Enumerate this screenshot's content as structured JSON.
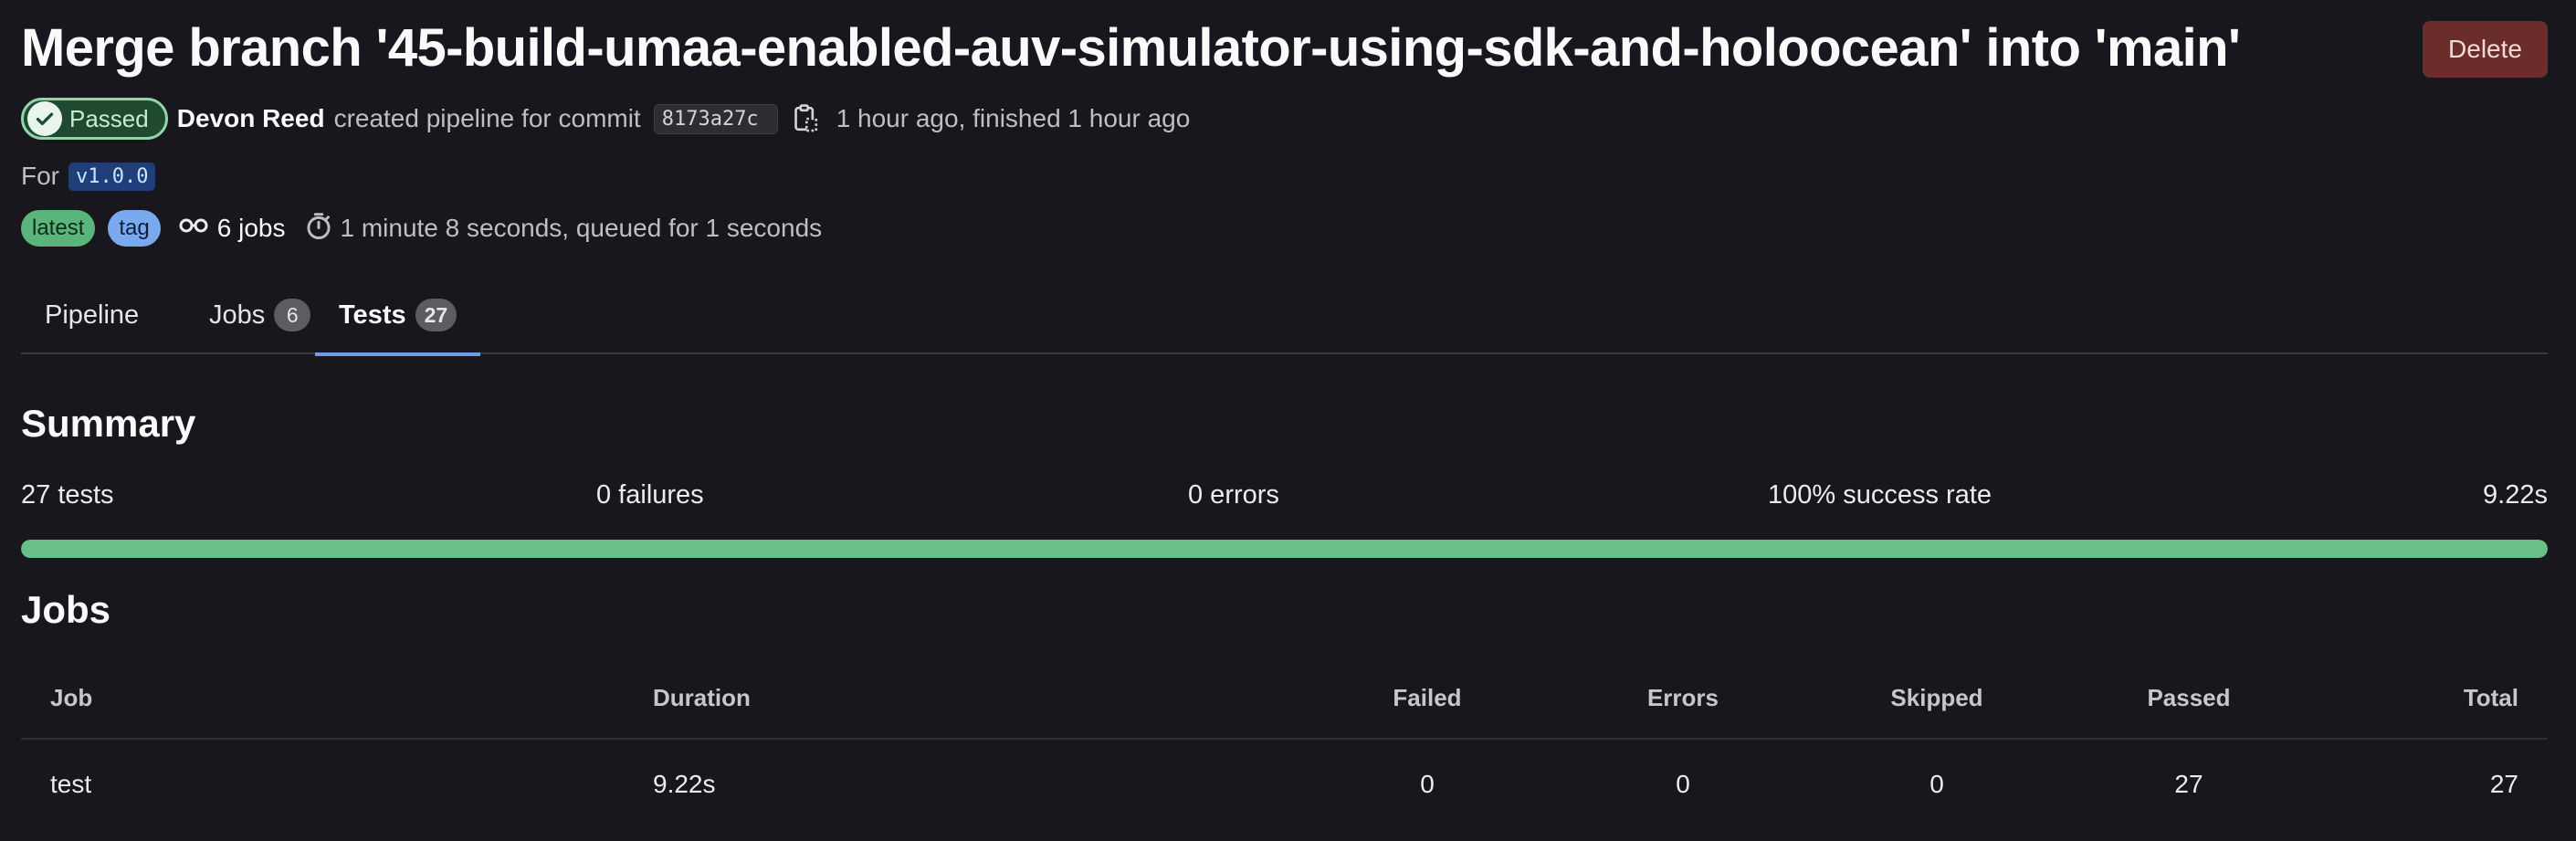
{
  "pipeline": {
    "title": "Merge branch '45-build-umaa-enabled-auv-simulator-using-sdk-and-holoocean' into 'main'",
    "delete_label": "Delete",
    "status_label": "Passed",
    "author": "Devon Reed",
    "action_text": "created pipeline for commit",
    "commit_sha": "8173a27c",
    "time_text": "1 hour ago, finished 1 hour ago",
    "for_label": "For",
    "ref": "v1.0.0",
    "badges": [
      "latest",
      "tag"
    ],
    "jobs_count_text": "6 jobs",
    "duration_text": "1 minute 8 seconds, queued for 1 seconds"
  },
  "tabs": [
    {
      "label": "Pipeline",
      "count": null,
      "active": false
    },
    {
      "label": "Jobs",
      "count": "6",
      "active": false
    },
    {
      "label": "Tests",
      "count": "27",
      "active": true
    }
  ],
  "summary": {
    "heading": "Summary",
    "tests": "27 tests",
    "failures": "0 failures",
    "errors": "0 errors",
    "success_rate": "100% success rate",
    "duration": "9.22s",
    "progress_fraction": 1.0
  },
  "jobs_section": {
    "heading": "Jobs",
    "columns": [
      "Job",
      "Duration",
      "Failed",
      "Errors",
      "Skipped",
      "Passed",
      "Total"
    ],
    "rows": [
      {
        "job": "test",
        "duration": "9.22s",
        "failed": "0",
        "errors": "0",
        "skipped": "0",
        "passed": "27",
        "total": "27"
      }
    ]
  },
  "colors": {
    "background": "#18171d",
    "success": "#6abf86",
    "delete": "#6a2d2a",
    "active_tab": "#6d9ce8"
  }
}
